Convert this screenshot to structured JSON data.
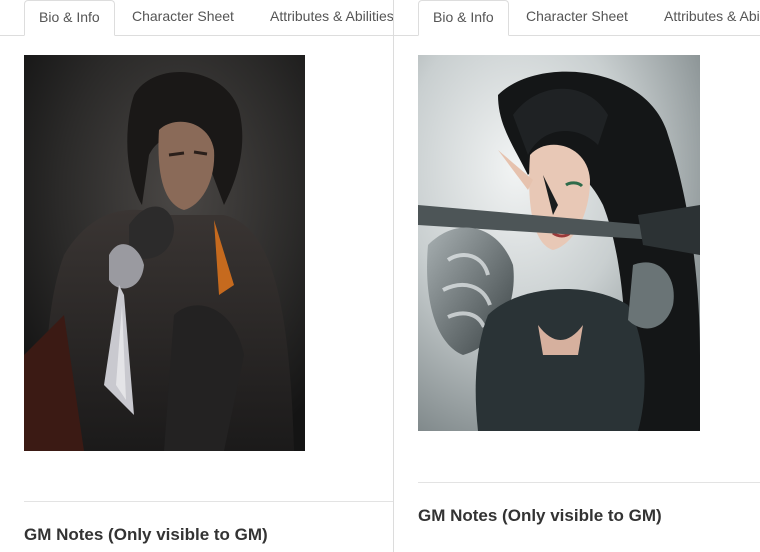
{
  "left_panel": {
    "tabs": [
      "Bio & Info",
      "Character Sheet",
      "Attributes & Abilities"
    ],
    "portrait_icon": "dark-swordsman-portrait",
    "gm_notes_heading": "GM Notes (Only visible to GM)"
  },
  "right_panel": {
    "tabs": [
      "Bio & Info",
      "Character Sheet",
      "Attributes & Abilities"
    ],
    "portrait_icon": "elf-warrior-portrait",
    "gm_notes_heading": "GM Notes (Only visible to GM)"
  },
  "colors": {
    "tab_border": "#dddddd",
    "heading_text": "#333333",
    "tab_text": "#555555"
  }
}
